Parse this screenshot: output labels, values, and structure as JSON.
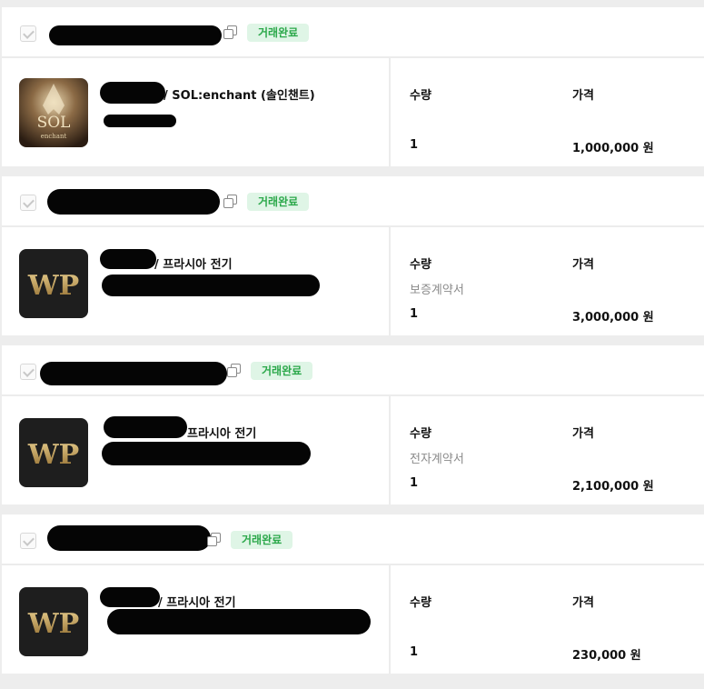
{
  "orders": [
    {
      "status": "거래완료",
      "product_title": "/ SOL:enchant (솔인챈트)",
      "game_logo_text": "SOL",
      "game_logo_sub": "enchant",
      "qty_label": "수량",
      "price_label": "가격",
      "contract": "",
      "quantity": "1",
      "price": "1,000,000 원"
    },
    {
      "status": "거래완료",
      "product_title": "/ 프라시아 전기",
      "game_logo_text": "WP",
      "qty_label": "수량",
      "price_label": "가격",
      "contract": "보증계약서",
      "quantity": "1",
      "price": "3,000,000 원"
    },
    {
      "status": "거래완료",
      "product_title": "프라시아 전기",
      "game_logo_text": "WP",
      "qty_label": "수량",
      "price_label": "가격",
      "contract": "전자계약서",
      "quantity": "1",
      "price": "2,100,000 원"
    },
    {
      "status": "거래완료",
      "product_title": "/ 프라시아 전기",
      "game_logo_text": "WP",
      "qty_label": "수량",
      "price_label": "가격",
      "contract": "",
      "quantity": "1",
      "price": "230,000 원"
    }
  ],
  "colors": {
    "status_bg": "#dff5e6",
    "status_text": "#2ba84a",
    "page_bg": "#ededed"
  }
}
